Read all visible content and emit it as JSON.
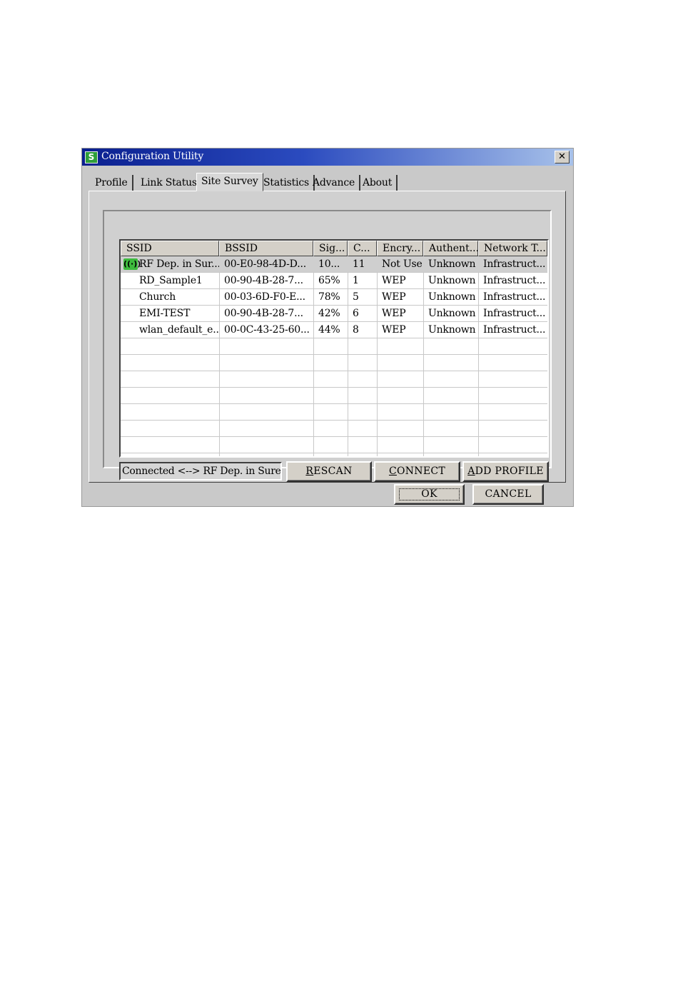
{
  "window": {
    "title": "Configuration Utility",
    "app_icon_glyph": "S",
    "close_glyph": "✕"
  },
  "tabs": [
    {
      "label": "Profile"
    },
    {
      "label": "Link Status"
    },
    {
      "label": "Site Survey",
      "active": true
    },
    {
      "label": "Statistics"
    },
    {
      "label": "Advance"
    },
    {
      "label": "About"
    }
  ],
  "site_survey": {
    "columns": [
      "SSID",
      "BSSID",
      "Sig...",
      "C...",
      "Encry...",
      "Authent...",
      "Network T..."
    ],
    "rows": [
      {
        "ssid": "RF Dep. in Sur...",
        "bssid": "00-E0-98-4D-D...",
        "signal": "10...",
        "channel": "11",
        "encryption": "Not Use",
        "auth": "Unknown",
        "network_type": "Infrastruct...",
        "connected": true
      },
      {
        "ssid": "RD_Sample1",
        "bssid": "00-90-4B-28-7...",
        "signal": "65%",
        "channel": "1",
        "encryption": "WEP",
        "auth": "Unknown",
        "network_type": "Infrastruct..."
      },
      {
        "ssid": "Church",
        "bssid": "00-03-6D-F0-E...",
        "signal": "78%",
        "channel": "5",
        "encryption": "WEP",
        "auth": "Unknown",
        "network_type": "Infrastruct..."
      },
      {
        "ssid": "EMI-TEST",
        "bssid": "00-90-4B-28-7...",
        "signal": "42%",
        "channel": "6",
        "encryption": "WEP",
        "auth": "Unknown",
        "network_type": "Infrastruct..."
      },
      {
        "ssid": "wlan_default_e...",
        "bssid": "00-0C-43-25-60...",
        "signal": "44%",
        "channel": "8",
        "encryption": "WEP",
        "auth": "Unknown",
        "network_type": "Infrastruct..."
      }
    ],
    "status_text": "Connected <--> RF Dep. in Surecor",
    "rescan": {
      "mnemonic": "R",
      "rest": "ESCAN"
    },
    "connect": {
      "mnemonic": "C",
      "rest": "ONNECT"
    },
    "add_profile": {
      "mnemonic": "A",
      "rest": "DD PROFILE"
    }
  },
  "footer": {
    "ok_label": "OK",
    "cancel_label": "CANCEL"
  },
  "colors": {
    "titlebar_start": "#0a1f8f",
    "titlebar_end": "#a8c2ea",
    "connected_icon": "#3dbb3d"
  },
  "icons": {
    "app": "app-logo-icon",
    "close": "close-icon",
    "connected": "connected-network-icon"
  }
}
